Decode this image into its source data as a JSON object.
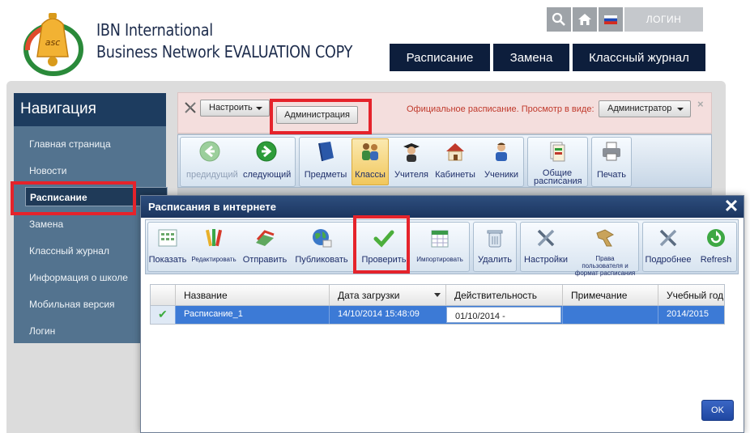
{
  "brand": {
    "line1": "IBN International",
    "line2": "Business Network EVALUATION COPY",
    "logo_text": "asc"
  },
  "topbar": {
    "icons": [
      "search-icon",
      "home-icon",
      "flag-icon"
    ],
    "login": "ЛОГИН"
  },
  "main_nav": [
    "Расписание",
    "Замена",
    "Классный журнал"
  ],
  "sidebar": {
    "title": "Навигация",
    "items": [
      "Главная страница",
      "Новости",
      "Расписание",
      "Замена",
      "Классный журнал",
      "Информация о школе",
      "Мобильная версия",
      "Логин"
    ],
    "active": "Расписание"
  },
  "admin_bar": {
    "configure": "Настроить",
    "admin_button": "Администрация",
    "official_text": "Официальное расписание.  Просмотр в виде:",
    "view_as": "Администратор",
    "close": "×"
  },
  "background_toolbar": {
    "prev": "предидущий",
    "next": "следующий",
    "subjects": "Предметы",
    "classes": "Классы",
    "teachers": "Учителя",
    "rooms": "Кабинеты",
    "students": "Ученики",
    "common1": "Общие",
    "common2": "расписания",
    "print": "Печать"
  },
  "modal": {
    "title": "Расписания в интернете",
    "close": "✕",
    "tools": {
      "show": "Показать",
      "edit": "Редактировать",
      "send": "Отправить",
      "publish": "Публиковать",
      "check": "Проверить",
      "import": "Импортировать",
      "delete": "Удалить",
      "settings": "Настройки",
      "rights1": "Права",
      "rights2": "пользователя и",
      "rights3": "формат расписания",
      "details": "Подробнее",
      "refresh": "Refresh"
    },
    "table": {
      "columns": [
        "Название",
        "Дата загрузки",
        "Действительность",
        "Примечание",
        "Учебный год"
      ],
      "rows": [
        {
          "check": "✔",
          "name": "Расписание_1",
          "uploaded": "14/10/2014 15:48:09",
          "validity": "01/10/2014 -",
          "note": "",
          "year": "2014/2015"
        }
      ]
    },
    "ok": "OK"
  },
  "colors": {
    "nav_dark": "#0d1e3c",
    "sidebar": "#53738f",
    "highlight": "#e5232b",
    "selected_row": "#3c7ad6"
  }
}
